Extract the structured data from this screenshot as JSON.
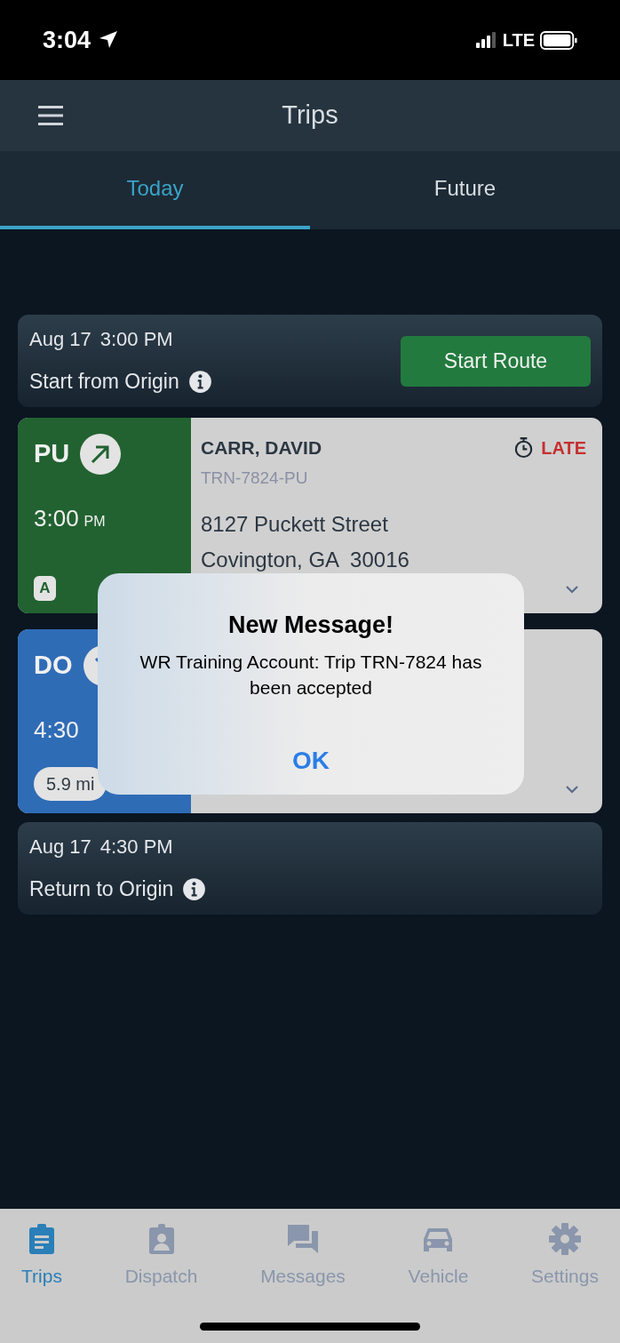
{
  "status_bar": {
    "time": "3:04",
    "network": "LTE"
  },
  "header": {
    "title": "Trips"
  },
  "tabs": [
    {
      "label": "Today",
      "selected": true
    },
    {
      "label": "Future",
      "selected": false
    }
  ],
  "route_start": {
    "date": "Aug 17",
    "time": "3:00 PM",
    "label": "Start from Origin",
    "button": "Start Route"
  },
  "stops": [
    {
      "kind": "pickup",
      "code": "PU",
      "time": "3:00",
      "meridiem": "PM",
      "badge": "A",
      "name": "CARR, DAVID",
      "trip_id": "TRN-7824-PU",
      "address": [
        "8127 Puckett Street",
        "Covington, GA  30016"
      ],
      "status": "LATE"
    },
    {
      "kind": "dropoff",
      "code": "DO",
      "time": "4:30",
      "distance": "5.9 mi"
    }
  ],
  "route_end": {
    "date": "Aug 17",
    "time": "4:30 PM",
    "label": "Return to Origin"
  },
  "dialog": {
    "title": "New Message!",
    "message": "WR Training Account: Trip TRN-7824 has been accepted",
    "button": "OK"
  },
  "nav": [
    {
      "label": "Trips",
      "selected": true
    },
    {
      "label": "Dispatch",
      "selected": false
    },
    {
      "label": "Messages",
      "selected": false
    },
    {
      "label": "Vehicle",
      "selected": false
    },
    {
      "label": "Settings",
      "selected": false
    }
  ]
}
